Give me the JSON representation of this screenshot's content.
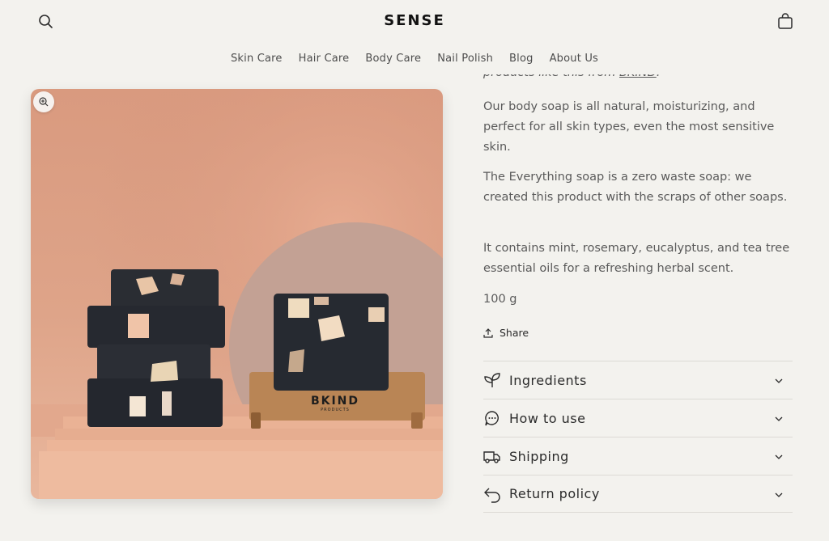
{
  "header": {
    "logo": "SENSE",
    "nav": [
      "Skin Care",
      "Hair Care",
      "Body Care",
      "Nail Polish",
      "Blog",
      "About Us"
    ]
  },
  "product": {
    "intro_prefix": "products like this from ",
    "intro_link": "BKIND",
    "intro_suffix": ".",
    "paragraphs": [
      "Our body soap is all natural, moisturizing, and perfect for all skin types, even the most sensitive skin.",
      "The Everything soap is a zero waste soap: we created this product with the scraps of other soaps.",
      "It contains mint, rosemary, eucalyptus, and tea tree essential oils for a refreshing herbal scent.",
      "100 g"
    ],
    "share_label": "Share",
    "image_brand": "BKIND",
    "image_brand_sub": "PRODUCTS"
  },
  "accordion": [
    {
      "label": "Ingredients",
      "icon": "leaf-icon"
    },
    {
      "label": "How to use",
      "icon": "chat-bubble-icon"
    },
    {
      "label": "Shipping",
      "icon": "truck-icon"
    },
    {
      "label": "Return policy",
      "icon": "return-arrow-icon"
    }
  ]
}
